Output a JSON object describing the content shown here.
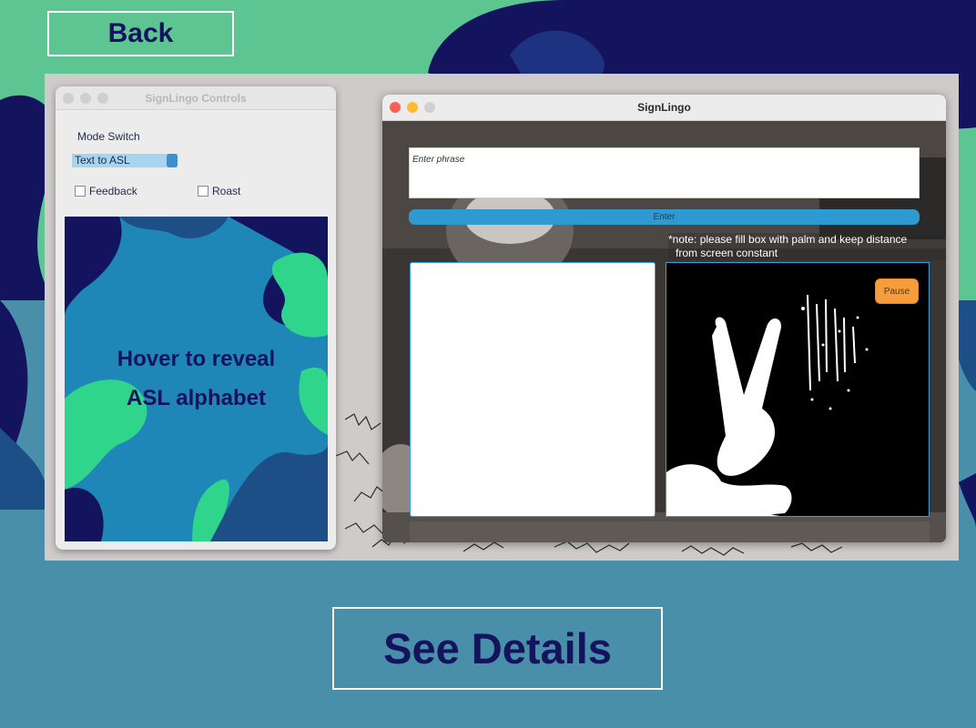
{
  "page": {
    "back_label": "Back",
    "details_label": "See Details"
  },
  "controls_window": {
    "title": "SignLingo Controls",
    "mode_label": "Mode Switch",
    "mode_value": "Text to ASL",
    "checkboxes": [
      {
        "label": "Feedback",
        "checked": false
      },
      {
        "label": "Roast",
        "checked": false
      }
    ],
    "reveal_line1": "Hover to reveal",
    "reveal_line2": "ASL alphabet"
  },
  "main_window": {
    "title": "SignLingo",
    "phrase_placeholder": "Enter phrase",
    "enter_label": "Enter",
    "note_line1": "*note: please fill box with palm and keep distance",
    "note_line2": "from screen constant",
    "pause_label": "Pause"
  },
  "colors": {
    "page_green": "#5dc591",
    "page_navy": "#14145e",
    "page_teal": "#4a8faa",
    "enter_blue": "#2f9ad1",
    "pause_orange": "#f59d3c"
  }
}
